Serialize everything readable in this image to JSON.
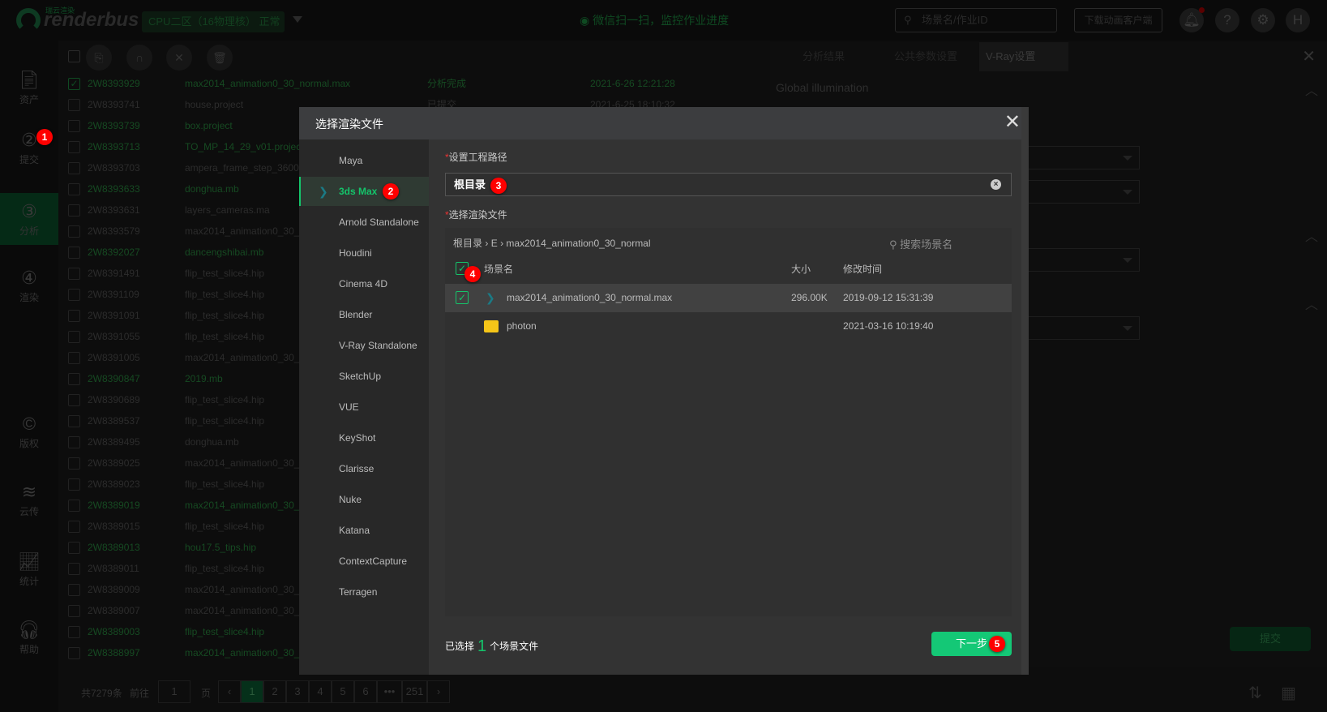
{
  "topbar": {
    "logo_text": "renderbus",
    "logo_sub": "瑞云渲染",
    "zone": "CPU二区（16物理核）  正常",
    "wechat": "微信扫一扫，监控作业进度",
    "search_placeholder": "场景名/作业ID",
    "download": "下载动画客户端",
    "avatar": "H"
  },
  "sidebar": {
    "items": [
      {
        "label": "资产"
      },
      {
        "label": "提交",
        "badge": "1"
      },
      {
        "label": "分析",
        "active": true
      },
      {
        "label": "渲染"
      },
      {
        "label": "版权"
      },
      {
        "label": "云传"
      },
      {
        "label": "统计"
      },
      {
        "label": "帮助"
      }
    ]
  },
  "jobs": [
    {
      "id": "2W8393929",
      "name": "max2014_animation0_30_normal.max",
      "status": "分析完成",
      "date": "2021-6-26 12:21:28",
      "green": true,
      "checked": true
    },
    {
      "id": "2W8393741",
      "name": "house.project",
      "status": "已提交",
      "date": "2021-6-25 18:10:32"
    },
    {
      "id": "2W8393739",
      "name": "box.project",
      "green": true
    },
    {
      "id": "2W8393713",
      "name": "TO_MP_14_29_v01.project",
      "green": true
    },
    {
      "id": "2W8393703",
      "name": "ampera_frame_step_3600"
    },
    {
      "id": "2W8393633",
      "name": "donghua.mb",
      "green": true
    },
    {
      "id": "2W8393631",
      "name": "layers_cameras.ma"
    },
    {
      "id": "2W8393579",
      "name": "max2014_animation0_30_"
    },
    {
      "id": "2W8392027",
      "name": "dancengshibai.mb",
      "green": true
    },
    {
      "id": "2W8391491",
      "name": "flip_test_slice4.hip"
    },
    {
      "id": "2W8391109",
      "name": "flip_test_slice4.hip"
    },
    {
      "id": "2W8391091",
      "name": "flip_test_slice4.hip"
    },
    {
      "id": "2W8391055",
      "name": "flip_test_slice4.hip"
    },
    {
      "id": "2W8391005",
      "name": "max2014_animation0_30_"
    },
    {
      "id": "2W8390847",
      "name": "2019.mb",
      "green": true
    },
    {
      "id": "2W8390689",
      "name": "flip_test_slice4.hip"
    },
    {
      "id": "2W8389537",
      "name": "flip_test_slice4.hip"
    },
    {
      "id": "2W8389495",
      "name": "donghua.mb"
    },
    {
      "id": "2W8389025",
      "name": "max2014_animation0_30_"
    },
    {
      "id": "2W8389023",
      "name": "flip_test_slice4.hip"
    },
    {
      "id": "2W8389019",
      "name": "max2014_animation0_30_",
      "green": true
    },
    {
      "id": "2W8389015",
      "name": "flip_test_slice4.hip"
    },
    {
      "id": "2W8389013",
      "name": "hou17.5_tips.hip",
      "green": true
    },
    {
      "id": "2W8389011",
      "name": "flip_test_slice4.hip"
    },
    {
      "id": "2W8389009",
      "name": "max2014_animation0_30_"
    },
    {
      "id": "2W8389007",
      "name": "max2014_animation0_30_"
    },
    {
      "id": "2W8389003",
      "name": "flip_test_slice4.hip",
      "green": true
    },
    {
      "id": "2W8388997",
      "name": "max2014_animation0_30_",
      "green": true
    }
  ],
  "pager": {
    "total": "共7279条",
    "goto": "前往",
    "goto_value": "1",
    "page_unit": "页",
    "pages": [
      "1",
      "2",
      "3",
      "4",
      "5",
      "6",
      "•••",
      "251"
    ],
    "current": "1"
  },
  "right_panel": {
    "tabs": [
      "分析结果",
      "公共参数设置",
      "V-Ray设置"
    ],
    "active_tab": "V-Ray设置",
    "section": "Global illumination",
    "submit": "提交"
  },
  "modal": {
    "title": "选择渲染文件",
    "software": [
      "Maya",
      "3ds Max",
      "Arnold Standalone",
      "Houdini",
      "Cinema 4D",
      "Blender",
      "V-Ray Standalone",
      "SketchUp",
      "VUE",
      "KeyShot",
      "Clarisse",
      "Nuke",
      "Katana",
      "ContextCapture",
      "Terragen"
    ],
    "selected_software": "3ds Max",
    "path_label": "设置工程路径",
    "path_value": "根目录",
    "file_label": "选择渲染文件",
    "breadcrumb": [
      "根目录",
      "E",
      "max2014_animation0_30_normal"
    ],
    "search_placeholder": "搜索场景名",
    "columns": {
      "name": "场景名",
      "size": "大小",
      "modified": "修改时间"
    },
    "files": [
      {
        "name": "max2014_animation0_30_normal.max",
        "size": "296.00K",
        "modified": "2019-09-12 15:31:39",
        "type": "max",
        "checked": true
      },
      {
        "name": "photon",
        "size": "",
        "modified": "2021-03-16 10:19:40",
        "type": "folder"
      }
    ],
    "footer": {
      "prefix": "已选择",
      "count": "1",
      "suffix": "个场景文件"
    },
    "next": "下一步"
  },
  "steps": [
    "1",
    "2",
    "3",
    "4",
    "5"
  ],
  "colors": {
    "accent": "#14c876",
    "badge": "#ff0000",
    "folder": "#f5c518"
  }
}
